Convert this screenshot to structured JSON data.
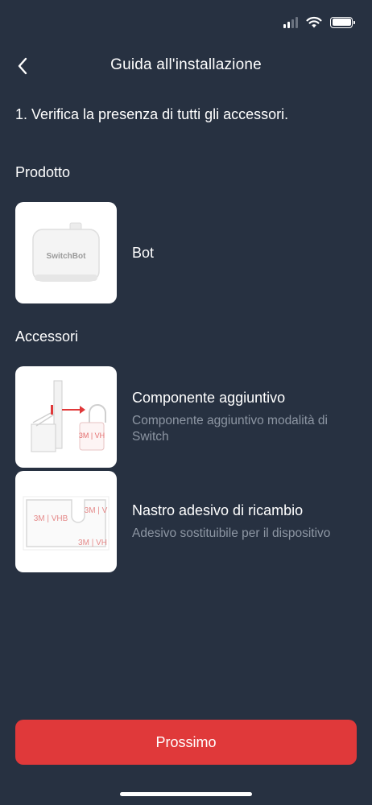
{
  "header": {
    "title": "Guida all'installazione"
  },
  "step_text": "1. Verifica la presenza di tutti gli accessori.",
  "sections": {
    "product_title": "Prodotto",
    "accessories_title": "Accessori"
  },
  "product": {
    "name": "Bot",
    "image_logo_text": "SwitchBot"
  },
  "accessories": [
    {
      "name": "Componente aggiuntivo",
      "description": "Componente aggiuntivo modalità di Switch",
      "image_label": "3M | VH"
    },
    {
      "name": "Nastro adesivo di ricambio",
      "description": "Adesivo sostituibile per il dispositivo",
      "image_label": "3M | VHB"
    }
  ],
  "primary_button": {
    "label": "Prossimo"
  },
  "colors": {
    "background": "#273141",
    "accent": "#e0393a",
    "secondary_text": "#8d96a3"
  }
}
